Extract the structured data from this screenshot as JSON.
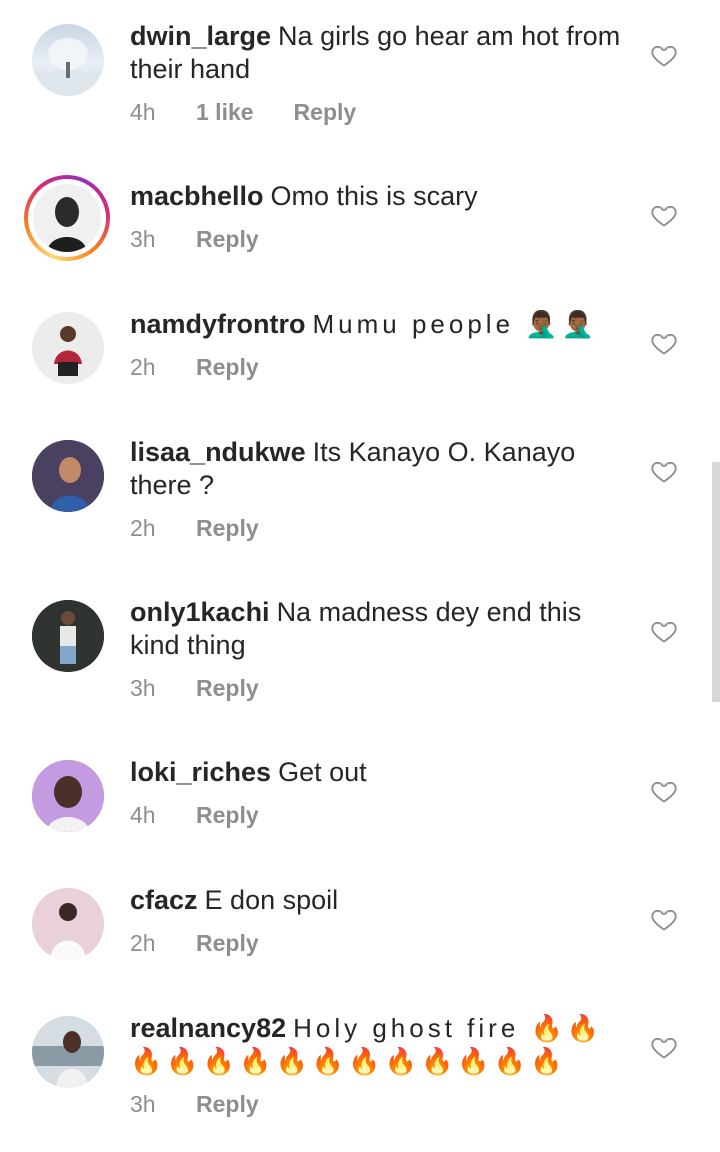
{
  "comments": [
    {
      "username": "dwin_large",
      "text": "Na girls go hear am hot from their hand",
      "time": "4h",
      "likes": "1 like",
      "reply": "Reply"
    },
    {
      "username": "macbhello",
      "text": "Omo this is scary",
      "time": "3h",
      "reply": "Reply"
    },
    {
      "username": "namdyfrontro",
      "text": "Mumu people 🤦🏾‍♂️🤦🏾‍♂️",
      "time": "2h",
      "reply": "Reply"
    },
    {
      "username": "lisaa_ndukwe",
      "text": "Its Kanayo O. Kanayo there ?",
      "time": "2h",
      "reply": "Reply"
    },
    {
      "username": "only1kachi",
      "text": "Na madness dey end this kind thing",
      "time": "3h",
      "reply": "Reply"
    },
    {
      "username": "loki_riches",
      "text": "Get out",
      "time": "4h",
      "reply": "Reply"
    },
    {
      "username": "cfacz",
      "text": "E don spoil",
      "time": "2h",
      "reply": "Reply"
    },
    {
      "username": "realnancy82",
      "text": "Holy ghost fire 🔥🔥🔥🔥🔥🔥🔥🔥🔥🔥🔥🔥🔥🔥",
      "time": "3h",
      "reply": "Reply"
    }
  ],
  "icons": {
    "like": "heart-outline-icon"
  },
  "colors": {
    "text": "#262626",
    "meta": "#8e8e8e"
  }
}
